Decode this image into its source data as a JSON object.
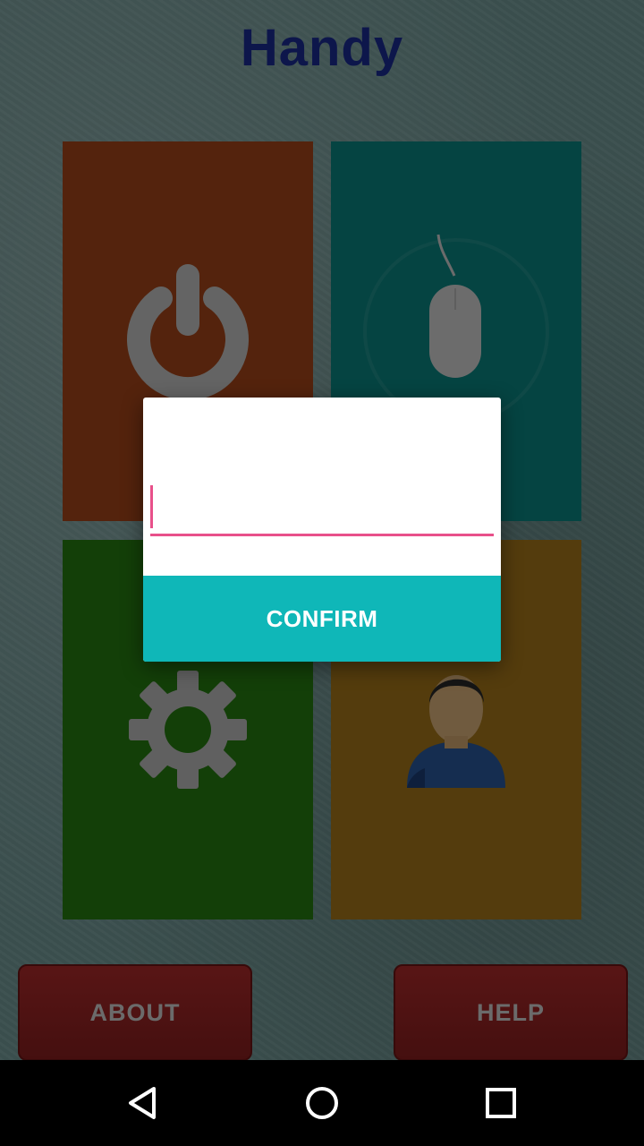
{
  "app": {
    "title": "Handy"
  },
  "tiles": [
    {
      "name": "power",
      "icon": "power-icon",
      "color": "#a9471a"
    },
    {
      "name": "mouse",
      "icon": "mouse-icon",
      "color": "#0b8985"
    },
    {
      "name": "settings",
      "icon": "gear-icon",
      "color": "#267e11"
    },
    {
      "name": "user",
      "icon": "user-icon",
      "color": "#a8781b"
    }
  ],
  "bottom_buttons": {
    "about_label": "ABOUT",
    "help_label": "HELP"
  },
  "dialog": {
    "input_value": "",
    "input_placeholder": "",
    "confirm_label": "CONFIRM",
    "accent_color": "#e8508a",
    "button_color": "#0fb7b8"
  },
  "navigation": {
    "back_icon": "back-triangle-icon",
    "home_icon": "home-circle-icon",
    "recent_icon": "recent-square-icon"
  }
}
